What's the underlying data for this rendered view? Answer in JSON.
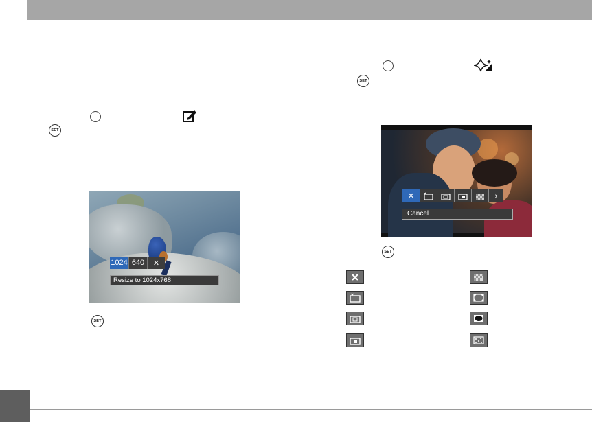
{
  "left_panel": {
    "options": [
      "1024",
      "640",
      "✕"
    ],
    "selected_option": 0,
    "caption": "Resize to 1024x768",
    "set_label": "SET"
  },
  "right_panel": {
    "options": [
      "✕",
      "",
      "",
      "",
      "",
      "›"
    ],
    "selected_option": 0,
    "caption": "Cancel",
    "set_label": "SET"
  },
  "colors": {
    "header_bar": "#a6a6a6",
    "selected": "#2f69b8",
    "footer_tab": "#5e5e5e"
  },
  "icons": {
    "left_glyph": "edit-resize-icon",
    "right_glyph": "sparkle-effect-icon",
    "effects_col1": [
      "cancel-effect-icon",
      "frame-1-icon",
      "frame-2-icon",
      "frame-3-icon"
    ],
    "effects_col2": [
      "mosaic-effect-icon",
      "frame-corners-icon",
      "vignette-icon",
      "sparkle-frame-icon"
    ]
  }
}
